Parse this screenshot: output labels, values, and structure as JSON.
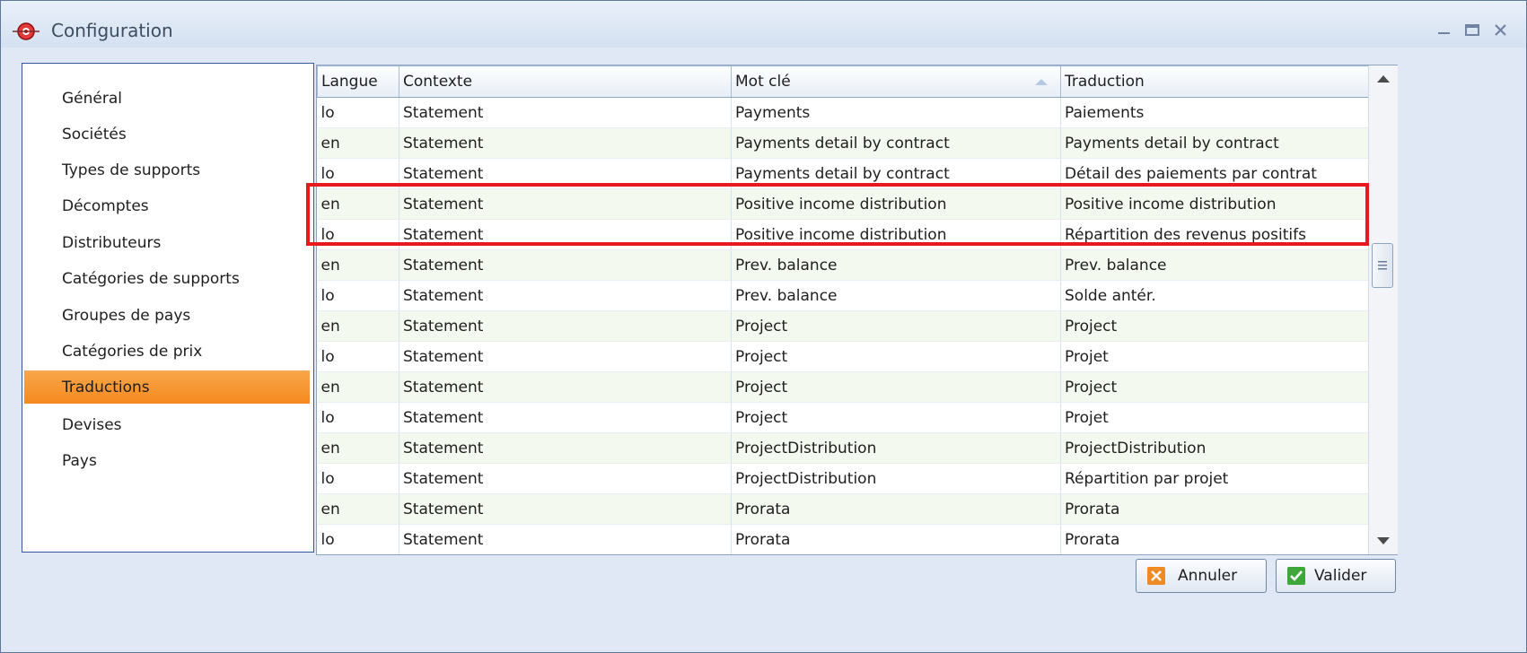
{
  "window": {
    "title": "Configuration"
  },
  "sidebar": {
    "items": [
      {
        "label": "Général",
        "active": false
      },
      {
        "label": "Sociétés",
        "active": false
      },
      {
        "label": "Types de supports",
        "active": false
      },
      {
        "label": "Décomptes",
        "active": false
      },
      {
        "label": "Distributeurs",
        "active": false
      },
      {
        "label": "Catégories de supports",
        "active": false
      },
      {
        "label": "Groupes de pays",
        "active": false
      },
      {
        "label": "Catégories de prix",
        "active": false
      },
      {
        "label": "Traductions",
        "active": true
      },
      {
        "label": "Devises",
        "active": false
      },
      {
        "label": "Pays",
        "active": false
      }
    ]
  },
  "grid": {
    "columns": [
      "Langue",
      "Contexte",
      "Mot clé",
      "Traduction"
    ],
    "sorted_column": "Mot clé",
    "sort_direction": "ascending",
    "rows": [
      [
        "lo",
        "Statement",
        "Payments",
        "Paiements"
      ],
      [
        "en",
        "Statement",
        "Payments detail by contract",
        "Payments detail by contract"
      ],
      [
        "lo",
        "Statement",
        "Payments detail by contract",
        "Détail des paiements par contrat"
      ],
      [
        "en",
        "Statement",
        "Positive income distribution",
        "Positive income distribution"
      ],
      [
        "lo",
        "Statement",
        "Positive income distribution",
        "Répartition des revenus positifs"
      ],
      [
        "en",
        "Statement",
        "Prev. balance",
        "Prev. balance"
      ],
      [
        "lo",
        "Statement",
        "Prev. balance",
        "Solde antér."
      ],
      [
        "en",
        "Statement",
        "Project",
        "Project"
      ],
      [
        "lo",
        "Statement",
        "Project",
        "Projet"
      ],
      [
        "en",
        "Statement",
        "Project",
        "Project"
      ],
      [
        "lo",
        "Statement",
        "Project",
        "Projet"
      ],
      [
        "en",
        "Statement",
        "ProjectDistribution",
        "ProjectDistribution"
      ],
      [
        "lo",
        "Statement",
        "ProjectDistribution",
        "Répartition par projet"
      ],
      [
        "en",
        "Statement",
        "Prorata",
        "Prorata"
      ],
      [
        "lo",
        "Statement",
        "Prorata",
        "Prorata"
      ]
    ],
    "highlighted_rows": [
      3,
      4
    ],
    "highlight_color": "#e8191e"
  },
  "buttons": {
    "cancel": {
      "label": "Annuler",
      "icon": "cancel-x-icon",
      "icon_color": "#f08a24"
    },
    "ok": {
      "label": "Valider",
      "icon": "check-icon",
      "icon_color": "#3fa63a"
    }
  },
  "colors": {
    "accent": "#f48a1e",
    "alt_row": "#f4f9ef",
    "border": "#34589a"
  }
}
